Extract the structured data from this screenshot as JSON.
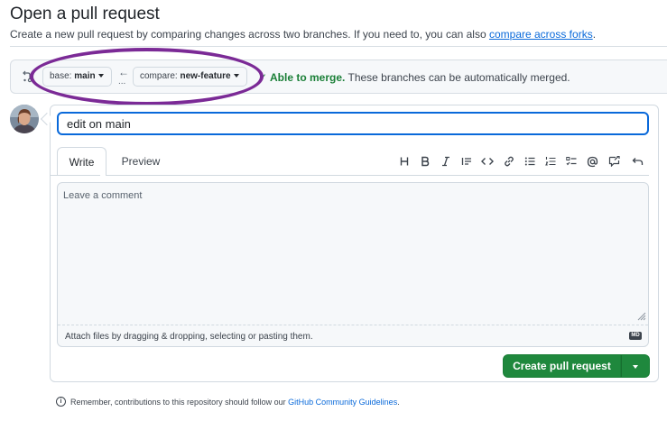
{
  "header": {
    "title": "Open a pull request",
    "subtitle": "Create a new pull request by comparing changes across two branches. If you need to, you can also",
    "subtitle_link": "compare across forks",
    "subtitle_end": "."
  },
  "range": {
    "base_label": "base:",
    "base_value": "main",
    "compare_label": "compare:",
    "compare_value": "new-feature",
    "swap_arrow": "←",
    "swap_dots": "...",
    "merge_check": "✓",
    "merge_title": "Able to merge.",
    "merge_desc": "These branches can be automatically merged."
  },
  "form": {
    "title_value": "edit on main",
    "tabs": [
      {
        "label": "Write"
      },
      {
        "label": "Preview"
      }
    ],
    "toolbar_icons": [
      "heading-icon",
      "bold-icon",
      "italic-icon",
      "quote-icon",
      "code-icon",
      "link-icon",
      "unordered-list-icon",
      "ordered-list-icon",
      "task-list-icon",
      "mention-icon",
      "reference-icon",
      "undo-icon"
    ],
    "comment_placeholder": "Leave a comment",
    "attach_text": "Attach files by dragging & dropping, selecting or pasting them.",
    "markdown_badge": "MD"
  },
  "actions": {
    "create_label": "Create pull request"
  },
  "footer": {
    "info": "i",
    "text": "Remember, contributions to this repository should follow our",
    "link": "GitHub Community Guidelines",
    "end": "."
  },
  "colors": {
    "primary_button": "#1f883d",
    "link": "#0969da",
    "merge_ok": "#1a7f37",
    "annotation_ring": "#7b2a96"
  }
}
